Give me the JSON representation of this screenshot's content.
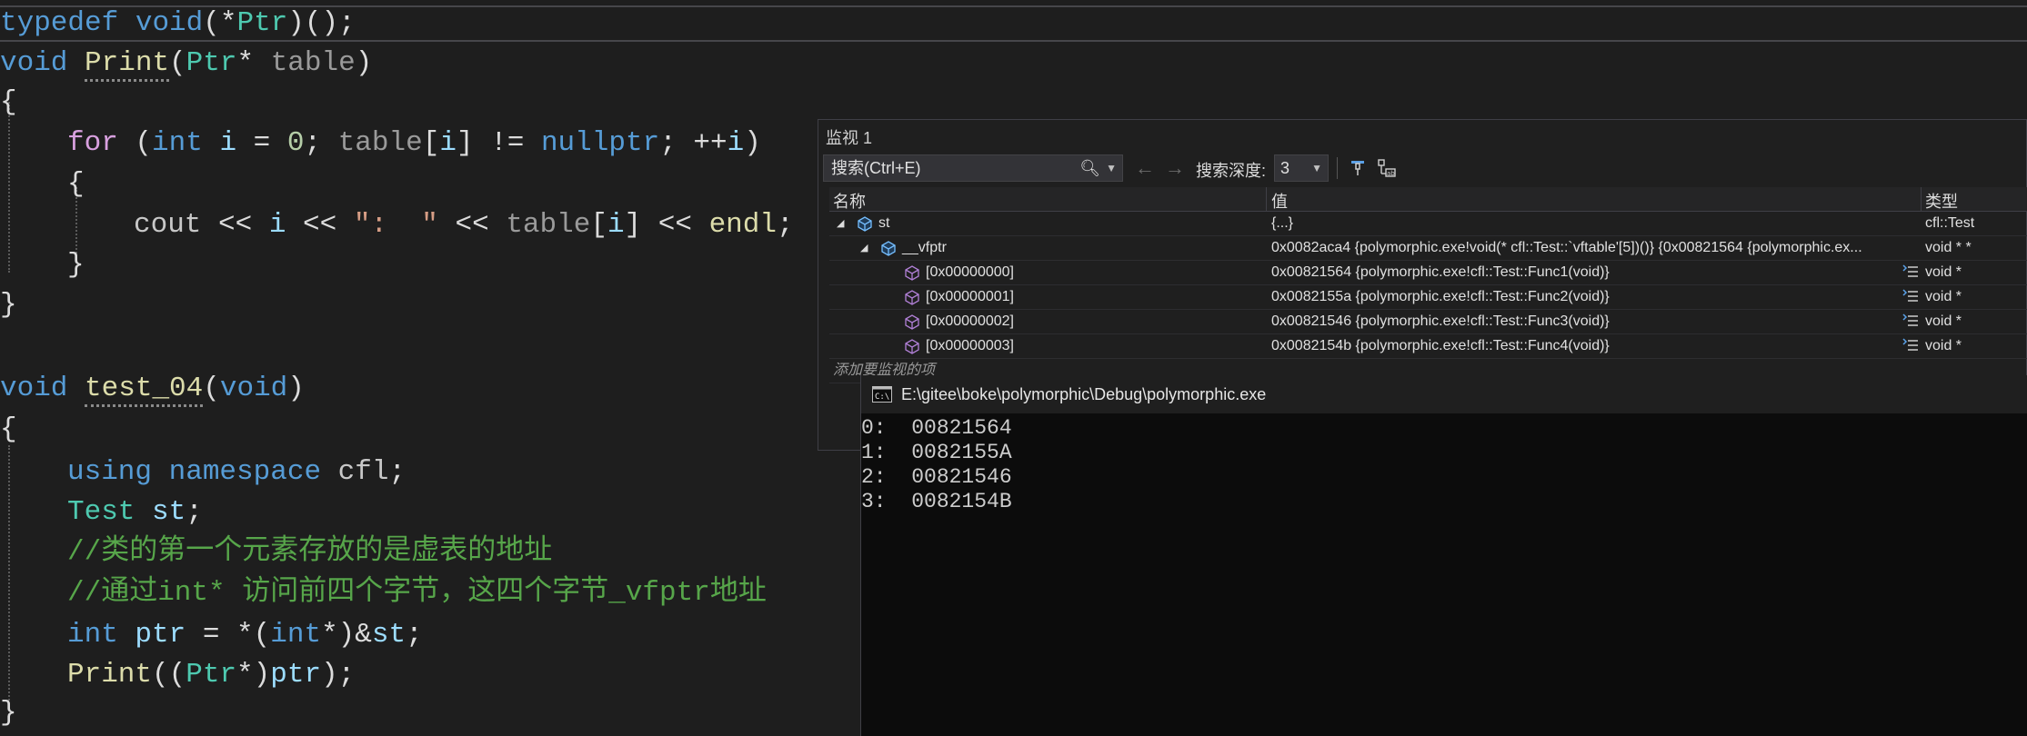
{
  "code": {
    "line1": {
      "kw": "typedef",
      "type": "void",
      "open": "(*",
      "name": "Ptr",
      "rest": ")();"
    },
    "line2": {
      "kw": "void",
      "fn": "Print",
      "open": "(",
      "type": "Ptr",
      "star": "*",
      "param": "table",
      "close": ")"
    },
    "line3": "{",
    "line4": {
      "for": "for",
      "open": " (",
      "int": "int",
      "i": "i",
      "eq": " = ",
      "zero": "0",
      "semi": "; ",
      "table": "table",
      "br1": "[",
      "i2": "i",
      "br2": "] != ",
      "nullptr": "nullptr",
      "semi2": "; ++",
      "i3": "i",
      "close": ")"
    },
    "line5": "{",
    "line6": {
      "cout": "cout",
      "op1": " << ",
      "i": "i",
      "op2": " << ",
      "str": "\":  \"",
      "op3": " << ",
      "table": "table",
      "br1": "[",
      "i2": "i",
      "br2": "]",
      "op4": " << ",
      "endl": "endl",
      "semi": ";"
    },
    "line7": "}",
    "line8": "}",
    "line9": {
      "kw": "void",
      "fn": "test_04",
      "open": "(",
      "param": "void",
      "close": ")"
    },
    "line10": "{",
    "line11": {
      "using": "using",
      "namespace": " namespace",
      "ns": " cfl",
      "semi": ";"
    },
    "line12": {
      "type": "Test",
      "var": " st",
      "semi": ";"
    },
    "line13": "//类的第一个元素存放的是虚表的地址",
    "line14": "//通过int* 访问前四个字节，这四个字节_vfptr地址",
    "line15": {
      "int": "int",
      "var": " ptr",
      "eq": " = *(",
      "int2": "int",
      "rest1": "*)&",
      "st": "st",
      "semi": ";"
    },
    "line16": {
      "fn": "Print",
      "open": "((",
      "type": "Ptr",
      "mid": "*)",
      "var": "ptr",
      "close": ");"
    },
    "line17": "}"
  },
  "watch": {
    "title": "监视 1",
    "search_placeholder": "搜索(Ctrl+E)",
    "depth_label": "搜索深度:",
    "depth_value": "3",
    "columns": {
      "name": "名称",
      "value": "值",
      "type": "类型"
    },
    "rows": [
      {
        "name": "st",
        "value": "{...}",
        "type": "cfl::Test"
      },
      {
        "name": "__vfptr",
        "value": "0x0082aca4 {polymorphic.exe!void(* cfl::Test::`vftable'[5])()} {0x00821564 {polymorphic.ex...",
        "type": "void * *"
      },
      {
        "name": "[0x00000000]",
        "value": "0x00821564 {polymorphic.exe!cfl::Test::Func1(void)}",
        "type": "void *"
      },
      {
        "name": "[0x00000001]",
        "value": "0x0082155a {polymorphic.exe!cfl::Test::Func2(void)}",
        "type": "void *"
      },
      {
        "name": "[0x00000002]",
        "value": "0x00821546 {polymorphic.exe!cfl::Test::Func3(void)}",
        "type": "void *"
      },
      {
        "name": "[0x00000003]",
        "value": "0x0082154b {polymorphic.exe!cfl::Test::Func4(void)}",
        "type": "void *"
      }
    ],
    "add_item": "添加要监视的项"
  },
  "console": {
    "title": "E:\\gitee\\boke\\polymorphic\\Debug\\polymorphic.exe",
    "lines": [
      "0:  00821564",
      "1:  0082155A",
      "2:  00821546",
      "3:  0082154B"
    ]
  },
  "colors": {
    "editor_bg": "#1e1e1e",
    "keyword": "#569cd6",
    "type": "#4ec9b0",
    "function": "#dcdcaa",
    "comment": "#57a64a",
    "console_bg": "#0c0c0c"
  }
}
